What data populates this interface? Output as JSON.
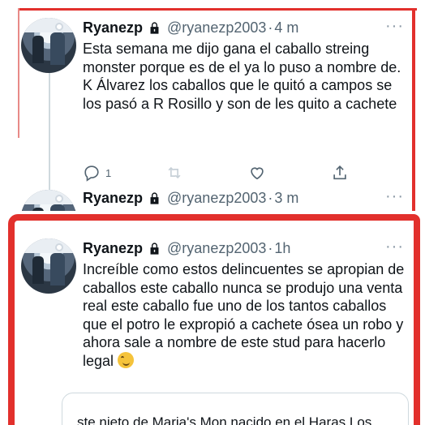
{
  "tweets": [
    {
      "name": "Ryanezp",
      "handle": "@ryanezp2003",
      "separator": "·",
      "time": "4 m",
      "text": "Esta semana me dijo gana el caballo streing monster porque es de el ya lo puso a nombre de. K Álvarez los caballos que le quitó a campos se los pasó a R Rosillo y son de les quito a cachete",
      "reply_count": "1",
      "more": "···"
    },
    {
      "name": "Ryanezp",
      "handle": "@ryanezp2003",
      "separator": "·",
      "time": "3 m",
      "more": "···"
    },
    {
      "name": "Ryanezp",
      "handle": "@ryanezp2003",
      "separator": "·",
      "time": "1h",
      "text": "Increíble como estos delincuentes se apropian de caballos este caballo nunca se produjo una venta real este caballo fue uno de los tantos caballos que el potro le expropió a cachete ósea un robo y ahora sale a nombre de este stud para hacerlo legal",
      "emoji": "grinning-sweat-face",
      "more": "···"
    }
  ],
  "quote": {
    "text": "ste nieto de Maria's Mon nacido en el Haras Los"
  },
  "icons": [
    "lock-icon",
    "reply-icon",
    "retweet-icon",
    "like-icon",
    "share-icon",
    "more-icon"
  ],
  "colors": {
    "annotation": "#e2302c",
    "text": "#0f1419",
    "secondary": "#536471",
    "border": "#cfd9de"
  }
}
